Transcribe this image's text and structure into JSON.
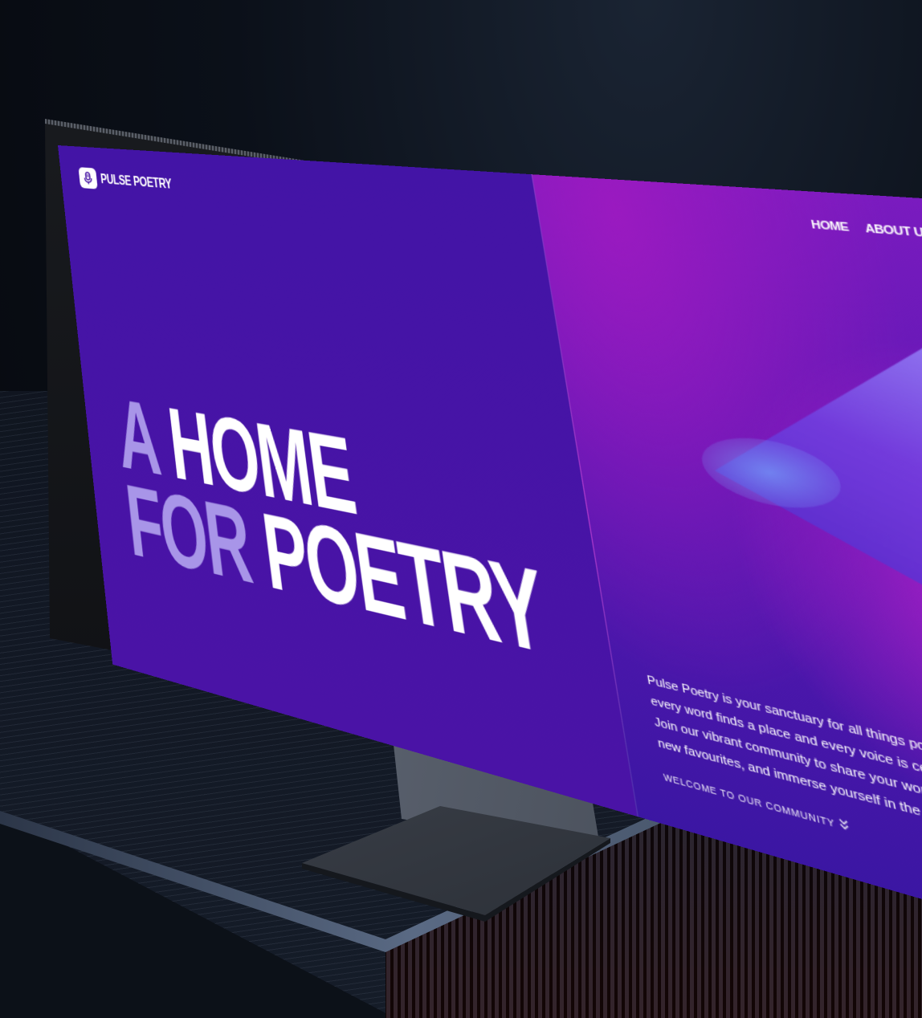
{
  "site": {
    "logo_text": "PULSE POETRY"
  },
  "nav": {
    "items": [
      {
        "label": "HOME"
      },
      {
        "label": "ABOUT US"
      }
    ]
  },
  "hero": {
    "line1_dim": "A",
    "line1_bright": "HOME",
    "line2_dim": "FOR",
    "line2_bright": "POETRY",
    "intro": "Pulse Poetry is your sanctuary for all things poetic, where every word finds a place and every voice is celebrated. Join our vibrant community to share your work, discover new favourites, and immerse yourself in the art of poetry.",
    "cta": "WELCOME TO OUR COMMUNITY"
  },
  "icons": {
    "logo": "microphone-icon",
    "cta": "double-chevron-down-icon"
  },
  "colors": {
    "primary": "#4513a3",
    "accent_magenta": "#b321c9",
    "headline_dim": "#a895e8",
    "text": "#ffffff"
  }
}
